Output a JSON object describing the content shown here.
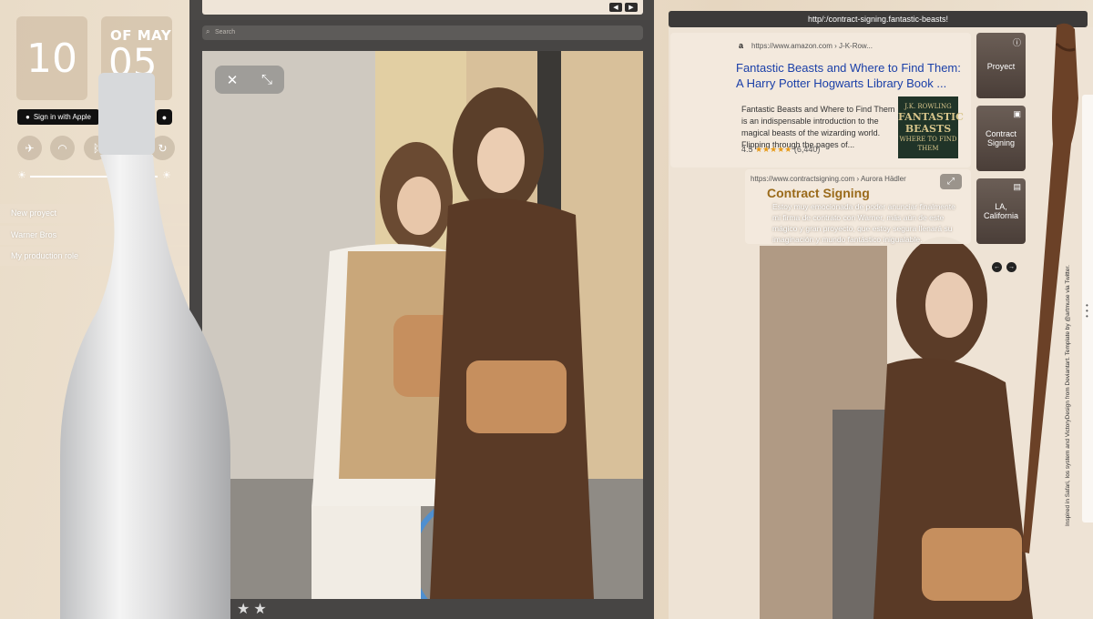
{
  "control_center": {
    "hour": "10",
    "month": "OF MAY",
    "day": "05",
    "apple_button_label": "Sign in with Apple",
    "toggles": [
      "airplane-icon",
      "wifi-icon",
      "bluetooth-icon",
      "rotation-lock-icon"
    ],
    "menu_items": [
      "New proyect",
      "Warner Bros",
      "My production role"
    ]
  },
  "browser": {
    "search_placeholder": "Search",
    "rating_stars": "★★"
  },
  "right_browser": {
    "url": "http/:/contract-signing.fantastic-beasts!",
    "amazon_result": {
      "url": "https://www.amazon.com › J-K-Row...",
      "title": "Fantastic Beasts and Where to Find Them: A Harry Potter Hogwarts Library Book ...",
      "description": "Fantastic Beasts and Where to Find Them is an indispensable introduction to the magical beasts of the wizarding world. Flipping through the pages of...",
      "rating": "4.5",
      "stars": "★★★★★",
      "reviews": "(6,440)",
      "book_cover_top": "J.K. ROWLING",
      "book_cover_title": "FANTASTIC BEASTS",
      "book_cover_sub": "WHERE TO FIND THEM"
    },
    "contract_result": {
      "url": "https://www.contractsigning.com › Aurora Hädler",
      "title": "Contract Signing",
      "description": "Estoy muy emocionada de poder anunciar finalmente mi firma de contrato con Warner, más aún de este mágico y gran proyecto, que estoy segura llenará su imaginación y mundo fantástico inigualable."
    },
    "tiles": [
      {
        "label": "Proyect",
        "icon": "info-icon"
      },
      {
        "label": "Contract Signing",
        "icon": "camera-icon"
      },
      {
        "label": "LA, California",
        "icon": "book-icon"
      }
    ],
    "credit": "Inspired in Safari, Ios system and VictoryDesign from Deviantart. Template by @artmuse via Twitter."
  }
}
